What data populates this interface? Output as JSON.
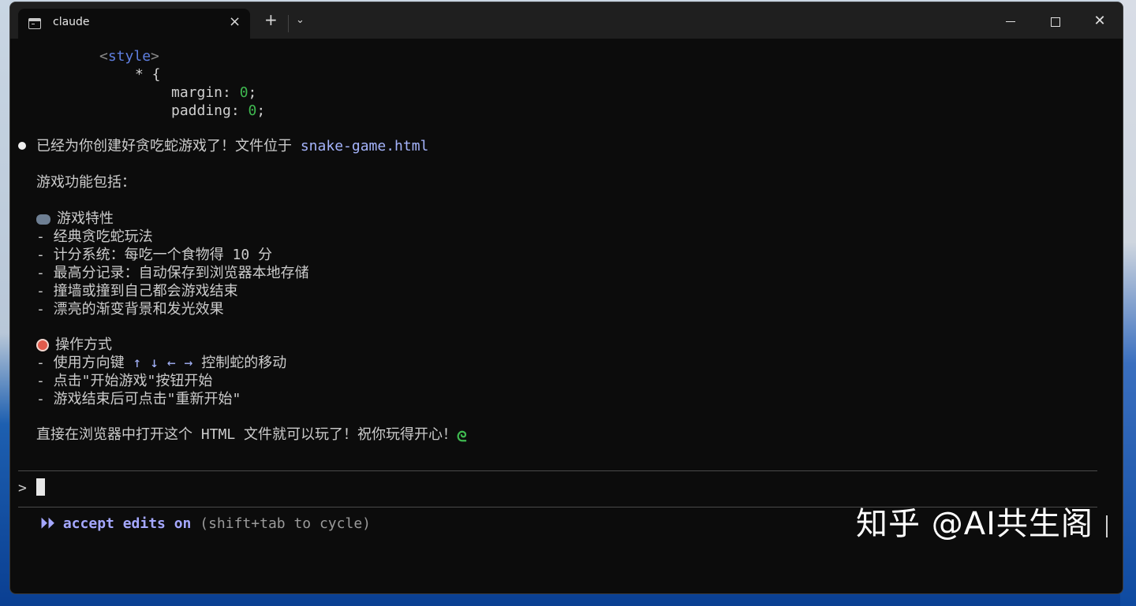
{
  "window": {
    "tab_title": "claude",
    "tab_close": "×",
    "new_tab": "+",
    "dropdown": "⌄",
    "close": "✕"
  },
  "code": {
    "style_open": "style",
    "selector": "* {",
    "margin_prop": "margin: ",
    "margin_val": "0",
    "padding_prop": "padding: ",
    "padding_val": "0",
    "semicolon": ";"
  },
  "message": {
    "intro": "已经为你创建好贪吃蛇游戏了！文件位于 ",
    "filename": "snake-game.html",
    "features_heading": "游戏功能包括：",
    "section1_title": "游戏特性",
    "section1_items": [
      "- 经典贪吃蛇玩法",
      "- 计分系统：每吃一个食物得 10 分",
      "- 最高分记录：自动保存到浏览器本地存储",
      "- 撞墙或撞到自己都会游戏结束",
      "- 漂亮的渐变背景和发光效果"
    ],
    "section2_title": "操作方式",
    "control_prefix": "- 使用方向键 ",
    "control_arrows": "↑ ↓ ← →",
    "control_suffix": " 控制蛇的移动",
    "section2_items": [
      "- 点击\"开始游戏\"按钮开始",
      "- 游戏结束后可点击\"重新开始\""
    ],
    "closing": "直接在浏览器中打开这个 HTML 文件就可以玩了！祝你玩得开心！",
    "closing_emoji": "ᘓ"
  },
  "prompt": {
    "symbol": ">",
    "value": ""
  },
  "status": {
    "arrows": "⏵⏵",
    "mode": "accept edits on",
    "hint": "(shift+tab to cycle)"
  },
  "watermark": "知乎 @AI共生阁"
}
